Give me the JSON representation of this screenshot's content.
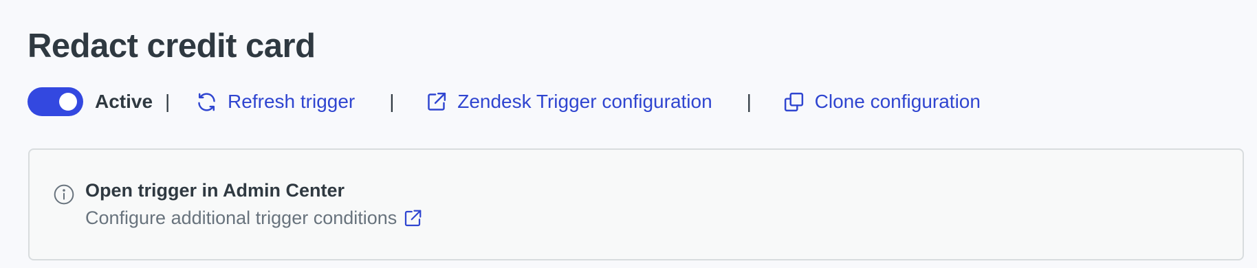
{
  "page": {
    "title": "Redact credit card"
  },
  "actions": {
    "toggle": {
      "state": "on",
      "color": "#3348e0"
    },
    "status_label": "Active",
    "separator": "|",
    "refresh": {
      "label": "Refresh trigger",
      "icon": "refresh-icon"
    },
    "zendesk": {
      "label": "Zendesk Trigger configuration",
      "icon": "external-link-icon"
    },
    "clone": {
      "label": "Clone configuration",
      "icon": "copy-icon"
    },
    "link_color": "#2f45d0"
  },
  "info": {
    "icon": "info-icon",
    "title": "Open trigger in Admin Center",
    "description": "Configure additional trigger conditions",
    "link_icon": "external-link-icon"
  }
}
